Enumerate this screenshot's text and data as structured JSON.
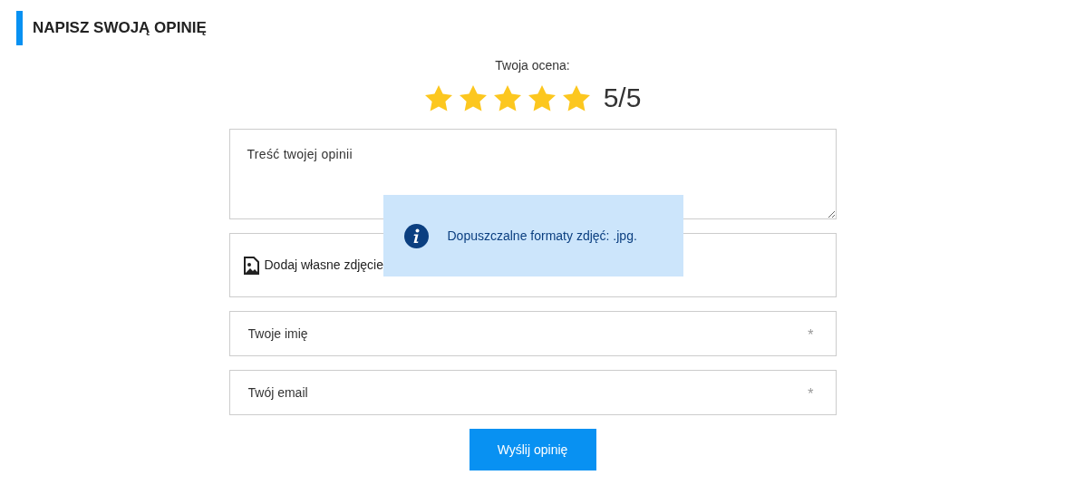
{
  "heading": "NAPISZ SWOJĄ OPINIĘ",
  "rating": {
    "label": "Twoja ocena:",
    "stars": 5,
    "reading": "5/5"
  },
  "review_field": {
    "placeholder": "Treść twojej opinii"
  },
  "photo_upload": {
    "label": "Dodaj własne zdjęcie"
  },
  "info_tooltip": {
    "text": "Dopuszczalne formaty zdjęć: .jpg."
  },
  "fields": [
    {
      "placeholder": "Twoje imię",
      "required_mark": "*"
    },
    {
      "placeholder": "Twój email",
      "required_mark": "*"
    }
  ],
  "submit_button": "Wyślij opinię"
}
